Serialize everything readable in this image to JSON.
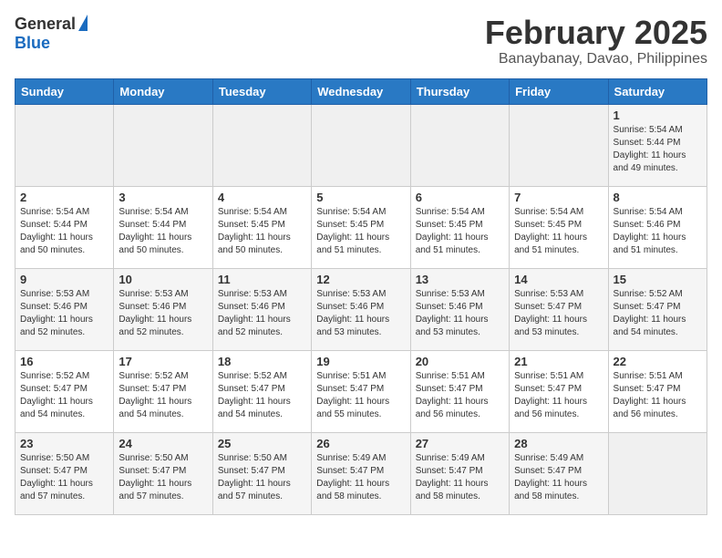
{
  "header": {
    "logo_line1": "General",
    "logo_line2": "Blue",
    "month": "February 2025",
    "location": "Banaybanay, Davao, Philippines"
  },
  "weekdays": [
    "Sunday",
    "Monday",
    "Tuesday",
    "Wednesday",
    "Thursday",
    "Friday",
    "Saturday"
  ],
  "weeks": [
    [
      {
        "day": "",
        "info": ""
      },
      {
        "day": "",
        "info": ""
      },
      {
        "day": "",
        "info": ""
      },
      {
        "day": "",
        "info": ""
      },
      {
        "day": "",
        "info": ""
      },
      {
        "day": "",
        "info": ""
      },
      {
        "day": "1",
        "info": "Sunrise: 5:54 AM\nSunset: 5:44 PM\nDaylight: 11 hours\nand 49 minutes."
      }
    ],
    [
      {
        "day": "2",
        "info": "Sunrise: 5:54 AM\nSunset: 5:44 PM\nDaylight: 11 hours\nand 50 minutes."
      },
      {
        "day": "3",
        "info": "Sunrise: 5:54 AM\nSunset: 5:44 PM\nDaylight: 11 hours\nand 50 minutes."
      },
      {
        "day": "4",
        "info": "Sunrise: 5:54 AM\nSunset: 5:45 PM\nDaylight: 11 hours\nand 50 minutes."
      },
      {
        "day": "5",
        "info": "Sunrise: 5:54 AM\nSunset: 5:45 PM\nDaylight: 11 hours\nand 51 minutes."
      },
      {
        "day": "6",
        "info": "Sunrise: 5:54 AM\nSunset: 5:45 PM\nDaylight: 11 hours\nand 51 minutes."
      },
      {
        "day": "7",
        "info": "Sunrise: 5:54 AM\nSunset: 5:45 PM\nDaylight: 11 hours\nand 51 minutes."
      },
      {
        "day": "8",
        "info": "Sunrise: 5:54 AM\nSunset: 5:46 PM\nDaylight: 11 hours\nand 51 minutes."
      }
    ],
    [
      {
        "day": "9",
        "info": "Sunrise: 5:53 AM\nSunset: 5:46 PM\nDaylight: 11 hours\nand 52 minutes."
      },
      {
        "day": "10",
        "info": "Sunrise: 5:53 AM\nSunset: 5:46 PM\nDaylight: 11 hours\nand 52 minutes."
      },
      {
        "day": "11",
        "info": "Sunrise: 5:53 AM\nSunset: 5:46 PM\nDaylight: 11 hours\nand 52 minutes."
      },
      {
        "day": "12",
        "info": "Sunrise: 5:53 AM\nSunset: 5:46 PM\nDaylight: 11 hours\nand 53 minutes."
      },
      {
        "day": "13",
        "info": "Sunrise: 5:53 AM\nSunset: 5:46 PM\nDaylight: 11 hours\nand 53 minutes."
      },
      {
        "day": "14",
        "info": "Sunrise: 5:53 AM\nSunset: 5:47 PM\nDaylight: 11 hours\nand 53 minutes."
      },
      {
        "day": "15",
        "info": "Sunrise: 5:52 AM\nSunset: 5:47 PM\nDaylight: 11 hours\nand 54 minutes."
      }
    ],
    [
      {
        "day": "16",
        "info": "Sunrise: 5:52 AM\nSunset: 5:47 PM\nDaylight: 11 hours\nand 54 minutes."
      },
      {
        "day": "17",
        "info": "Sunrise: 5:52 AM\nSunset: 5:47 PM\nDaylight: 11 hours\nand 54 minutes."
      },
      {
        "day": "18",
        "info": "Sunrise: 5:52 AM\nSunset: 5:47 PM\nDaylight: 11 hours\nand 54 minutes."
      },
      {
        "day": "19",
        "info": "Sunrise: 5:51 AM\nSunset: 5:47 PM\nDaylight: 11 hours\nand 55 minutes."
      },
      {
        "day": "20",
        "info": "Sunrise: 5:51 AM\nSunset: 5:47 PM\nDaylight: 11 hours\nand 56 minutes."
      },
      {
        "day": "21",
        "info": "Sunrise: 5:51 AM\nSunset: 5:47 PM\nDaylight: 11 hours\nand 56 minutes."
      },
      {
        "day": "22",
        "info": "Sunrise: 5:51 AM\nSunset: 5:47 PM\nDaylight: 11 hours\nand 56 minutes."
      }
    ],
    [
      {
        "day": "23",
        "info": "Sunrise: 5:50 AM\nSunset: 5:47 PM\nDaylight: 11 hours\nand 57 minutes."
      },
      {
        "day": "24",
        "info": "Sunrise: 5:50 AM\nSunset: 5:47 PM\nDaylight: 11 hours\nand 57 minutes."
      },
      {
        "day": "25",
        "info": "Sunrise: 5:50 AM\nSunset: 5:47 PM\nDaylight: 11 hours\nand 57 minutes."
      },
      {
        "day": "26",
        "info": "Sunrise: 5:49 AM\nSunset: 5:47 PM\nDaylight: 11 hours\nand 58 minutes."
      },
      {
        "day": "27",
        "info": "Sunrise: 5:49 AM\nSunset: 5:47 PM\nDaylight: 11 hours\nand 58 minutes."
      },
      {
        "day": "28",
        "info": "Sunrise: 5:49 AM\nSunset: 5:47 PM\nDaylight: 11 hours\nand 58 minutes."
      },
      {
        "day": "",
        "info": ""
      }
    ]
  ]
}
